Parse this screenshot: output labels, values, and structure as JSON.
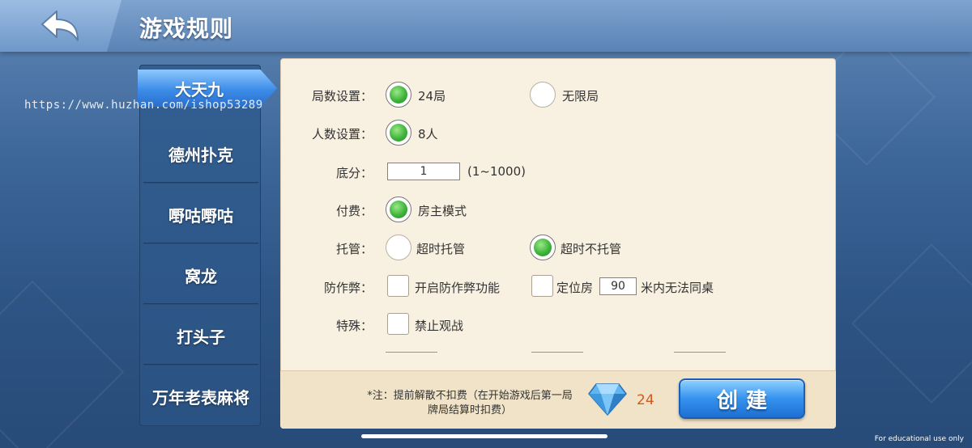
{
  "header": {
    "title": "游戏规则",
    "back_icon": "back-arrow-icon"
  },
  "tabs": [
    {
      "label": "大天九",
      "active": true
    },
    {
      "label": "德州扑克",
      "active": false
    },
    {
      "label": "嘢咕嘢咕",
      "active": false
    },
    {
      "label": "窝龙",
      "active": false
    },
    {
      "label": "打头子",
      "active": false
    },
    {
      "label": "万年老表麻将",
      "active": false
    }
  ],
  "watermark": "https://www.huzhan.com/ishop53289",
  "rules": {
    "rounds": {
      "label": "局数设置：",
      "options": [
        {
          "label": "24局",
          "selected": true
        },
        {
          "label": "无限局",
          "selected": false
        }
      ]
    },
    "players": {
      "label": "人数设置：",
      "options": [
        {
          "label": "8人",
          "selected": true
        }
      ]
    },
    "base_score": {
      "label": "底分：",
      "value": "1",
      "range": "(1~1000)"
    },
    "payment": {
      "label": "付费：",
      "options": [
        {
          "label": "房主模式",
          "selected": true
        }
      ]
    },
    "hosting": {
      "label": "托管：",
      "options": [
        {
          "label": "超时托管",
          "selected": false
        },
        {
          "label": "超时不托管",
          "selected": true
        }
      ]
    },
    "anti_cheat": {
      "label": "防作弊：",
      "enable_label": "开启防作弊功能",
      "enable_checked": false,
      "location_label": "定位房",
      "location_checked": false,
      "distance_value": "90",
      "distance_suffix": "米内无法同桌"
    },
    "special": {
      "label": "特殊：",
      "no_spectate_label": "禁止观战",
      "no_spectate_checked": false
    }
  },
  "footer": {
    "note_line1": "*注：提前解散不扣费（在开始游戏后第一局",
    "note_line2": "牌局结算时扣费）",
    "diamond_icon": "diamond-icon",
    "diamond_count": "24",
    "create_label": "创建"
  },
  "edu_note": "For educational use only",
  "colors": {
    "accent_blue": "#3592ee",
    "radio_green": "#3fb43c",
    "panel_bg": "#f8f1e2",
    "diamond_count": "#d2591f"
  }
}
